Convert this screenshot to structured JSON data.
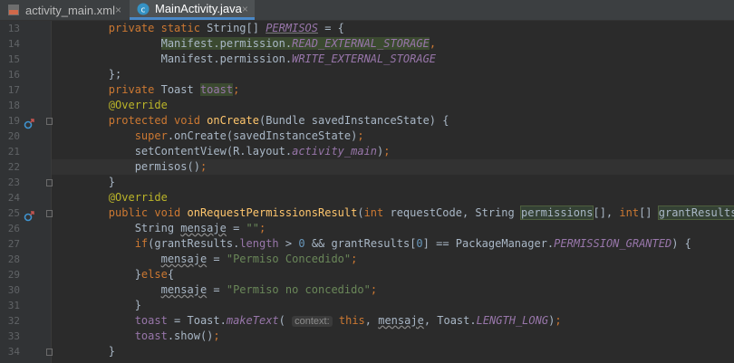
{
  "tabs": [
    {
      "label": "activity_main.xml",
      "icon": "xml-file-icon",
      "active": false
    },
    {
      "label": "MainActivity.java",
      "icon": "java-class-icon",
      "active": true
    }
  ],
  "lines": [
    {
      "n": "13",
      "seg": [
        [
          "",
          "        "
        ],
        [
          "kw",
          "private static "
        ],
        [
          "",
          "String[] "
        ],
        [
          "fld unused",
          "PERMISOS"
        ],
        [
          "",
          " = {"
        ]
      ]
    },
    {
      "n": "14",
      "seg": [
        [
          "",
          "                "
        ],
        [
          "hl",
          "Manifest.permission."
        ],
        [
          "fld hl",
          "READ_EXTERNAL_STORAGE"
        ],
        [
          "kw",
          ","
        ]
      ]
    },
    {
      "n": "15",
      "seg": [
        [
          "",
          "                Manifest.permission."
        ],
        [
          "fld",
          "WRITE_EXTERNAL_STORAGE"
        ]
      ]
    },
    {
      "n": "16",
      "seg": [
        [
          "",
          "        };"
        ]
      ]
    },
    {
      "n": "17",
      "seg": [
        [
          "",
          "        "
        ],
        [
          "kw",
          "private "
        ],
        [
          "",
          "Toast "
        ],
        [
          "fldp hl",
          "toast"
        ],
        [
          "kw",
          ";"
        ]
      ]
    },
    {
      "n": "18",
      "seg": [
        [
          "",
          "        "
        ],
        [
          "ann",
          "@Override"
        ]
      ]
    },
    {
      "n": "19",
      "seg": [
        [
          "",
          "        "
        ],
        [
          "kw",
          "protected void "
        ],
        [
          "fn",
          "onCreate"
        ],
        [
          "",
          "(Bundle savedInstanceState) {"
        ]
      ]
    },
    {
      "n": "20",
      "seg": [
        [
          "",
          "            "
        ],
        [
          "kw",
          "super"
        ],
        [
          "",
          ".onCreate(savedInstanceState)"
        ],
        [
          "kw",
          ";"
        ]
      ]
    },
    {
      "n": "21",
      "seg": [
        [
          "",
          "            setContentView(R.layout."
        ],
        [
          "fld",
          "activity_main"
        ],
        [
          "",
          ")"
        ],
        [
          "kw",
          ";"
        ]
      ]
    },
    {
      "n": "22",
      "seg": [
        [
          "",
          "            permisos()"
        ],
        [
          "kw",
          ";"
        ]
      ]
    },
    {
      "n": "23",
      "seg": [
        [
          "",
          "        }"
        ]
      ]
    },
    {
      "n": "24",
      "seg": [
        [
          "",
          "        "
        ],
        [
          "ann",
          "@Override"
        ]
      ]
    },
    {
      "n": "25",
      "seg": [
        [
          "",
          "        "
        ],
        [
          "kw",
          "public void "
        ],
        [
          "fn",
          "onRequestPermissionsResult"
        ],
        [
          "",
          "("
        ],
        [
          "kw",
          "int "
        ],
        [
          "",
          "requestCode, String "
        ],
        [
          "hlbox",
          "permissions"
        ],
        [
          "",
          "[], "
        ],
        [
          "kw",
          "int"
        ],
        [
          "",
          "[] "
        ],
        [
          "hlbox",
          "grantResults"
        ],
        [
          "",
          "){"
        ]
      ]
    },
    {
      "n": "26",
      "seg": [
        [
          "",
          "            String "
        ],
        [
          "wavy",
          "mensaje"
        ],
        [
          "",
          " = "
        ],
        [
          "str",
          "\"\""
        ],
        [
          "kw",
          ";"
        ]
      ]
    },
    {
      "n": "27",
      "seg": [
        [
          "",
          "            "
        ],
        [
          "kw",
          "if"
        ],
        [
          "",
          "(grantResults."
        ],
        [
          "fldp",
          "length"
        ],
        [
          "",
          " > "
        ],
        [
          "num",
          "0"
        ],
        [
          "",
          " && grantResults["
        ],
        [
          "num",
          "0"
        ],
        [
          "",
          "] == PackageManager."
        ],
        [
          "fld",
          "PERMISSION_GRANTED"
        ],
        [
          "",
          ") {"
        ]
      ]
    },
    {
      "n": "28",
      "seg": [
        [
          "",
          "                "
        ],
        [
          "wavy",
          "mensaje"
        ],
        [
          "",
          " = "
        ],
        [
          "str",
          "\"Permiso Concedido\""
        ],
        [
          "kw",
          ";"
        ]
      ]
    },
    {
      "n": "29",
      "seg": [
        [
          "",
          "            }"
        ],
        [
          "kw",
          "else"
        ],
        [
          "",
          "{"
        ]
      ]
    },
    {
      "n": "30",
      "seg": [
        [
          "",
          "                "
        ],
        [
          "wavy",
          "mensaje"
        ],
        [
          "",
          " = "
        ],
        [
          "str",
          "\"Permiso no concedido\""
        ],
        [
          "kw",
          ";"
        ]
      ]
    },
    {
      "n": "31",
      "seg": [
        [
          "",
          "            }"
        ]
      ]
    },
    {
      "n": "32",
      "seg": [
        [
          "",
          "            "
        ],
        [
          "fldp",
          "toast"
        ],
        [
          "",
          " = Toast."
        ],
        [
          "fld",
          "makeText"
        ],
        [
          "",
          "( "
        ],
        [
          "hint",
          "context:"
        ],
        [
          "",
          " "
        ],
        [
          "kw",
          "this"
        ],
        [
          "",
          ", "
        ],
        [
          "wavy",
          "mensaje"
        ],
        [
          "",
          ", Toast."
        ],
        [
          "fld",
          "LENGTH_LONG"
        ],
        [
          "",
          ")"
        ],
        [
          "kw",
          ";"
        ]
      ]
    },
    {
      "n": "33",
      "seg": [
        [
          "",
          "            "
        ],
        [
          "fldp",
          "toast"
        ],
        [
          "",
          ".show()"
        ],
        [
          "kw",
          ";"
        ]
      ]
    },
    {
      "n": "34",
      "seg": [
        [
          "",
          "        }"
        ]
      ]
    }
  ]
}
